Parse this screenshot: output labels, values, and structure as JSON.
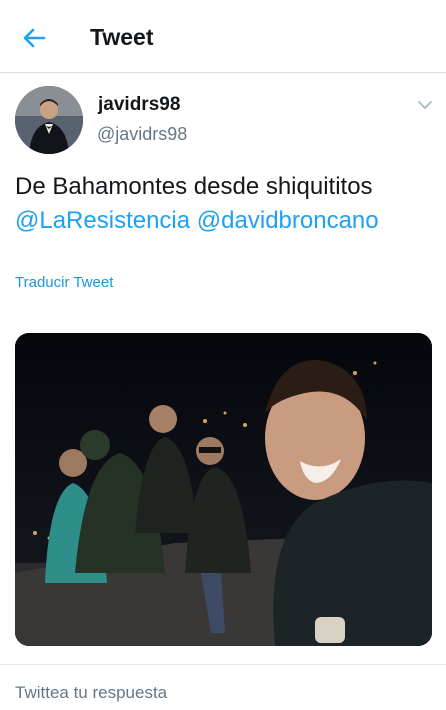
{
  "header": {
    "title": "Tweet",
    "back_icon": "back-arrow-icon",
    "accent_color": "#1da1f2"
  },
  "tweet": {
    "display_name": "javidrs98",
    "handle": "@javidrs98",
    "text": "De Bahamontes desde shiquititos",
    "mentions": [
      "@LaResistencia",
      "@davidbroncano"
    ],
    "translate_label": "Traducir Tweet",
    "menu_icon": "chevron-down-icon",
    "media_icon": "photo"
  },
  "reply": {
    "placeholder": "Twittea tu respuesta"
  }
}
